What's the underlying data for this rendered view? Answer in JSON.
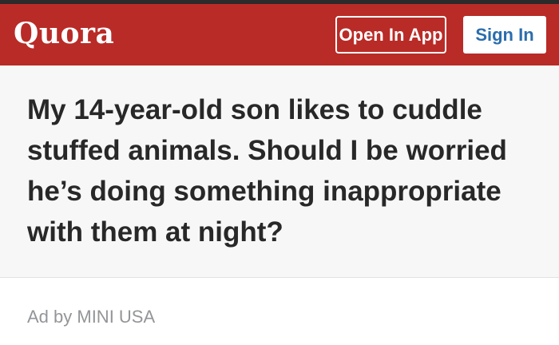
{
  "header": {
    "logo_text": "Quora",
    "open_in_app_label": "Open In App",
    "sign_in_label": "Sign In",
    "brand_color": "#b92b27"
  },
  "question": {
    "title": "My 14-year-old son likes to cuddle stuffed animals. Should I be worried he’s doing something inappropriate with them at night?"
  },
  "ad": {
    "label": "Ad by MINI USA"
  }
}
